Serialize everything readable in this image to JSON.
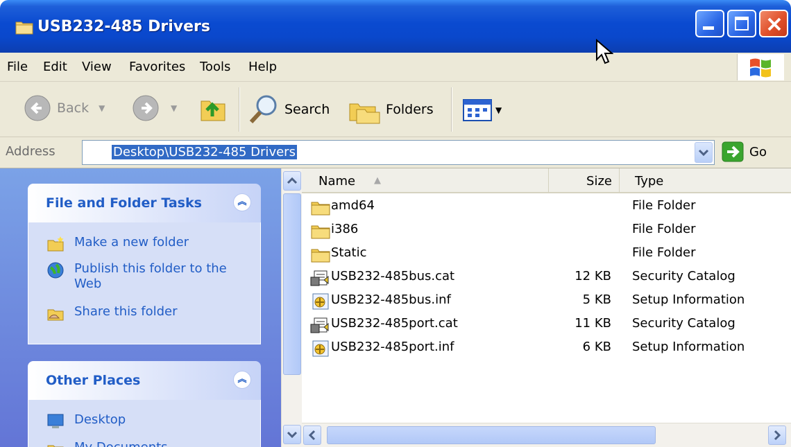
{
  "window": {
    "title": "USB232-485 Drivers",
    "icon": "folder-icon",
    "controls": [
      "minimize-icon",
      "maximize-icon",
      "close-icon"
    ]
  },
  "menu": {
    "items": [
      "File",
      "Edit",
      "View",
      "Favorites",
      "Tools",
      "Help"
    ]
  },
  "toolbar": {
    "back_label": "Back",
    "search_label": "Search",
    "folders_label": "Folders"
  },
  "address": {
    "label": "Address",
    "value": "Desktop\\USB232-485 Drivers",
    "go_label": "Go"
  },
  "taskpane": {
    "file_tasks": {
      "title": "File and Folder Tasks",
      "items": [
        {
          "label": "Make a new folder",
          "icon": "new-folder-icon"
        },
        {
          "label": "Publish this folder to the Web",
          "icon": "publish-web-icon"
        },
        {
          "label": "Share this folder",
          "icon": "share-folder-icon"
        }
      ]
    },
    "other_places": {
      "title": "Other Places",
      "items": [
        {
          "label": "Desktop",
          "icon": "desktop-icon"
        },
        {
          "label": "My Documents",
          "icon": "my-documents-icon"
        }
      ]
    }
  },
  "listview": {
    "columns": [
      "Name",
      "Size",
      "Type"
    ],
    "files": [
      {
        "name": "amd64",
        "size": "",
        "type": "File Folder",
        "icon": "folder-icon"
      },
      {
        "name": "i386",
        "size": "",
        "type": "File Folder",
        "icon": "folder-icon"
      },
      {
        "name": "Static",
        "size": "",
        "type": "File Folder",
        "icon": "folder-icon"
      },
      {
        "name": "USB232-485bus.cat",
        "size": "12 KB",
        "type": "Security Catalog",
        "icon": "security-catalog-icon"
      },
      {
        "name": "USB232-485bus.inf",
        "size": "5 KB",
        "type": "Setup Information",
        "icon": "setup-info-icon"
      },
      {
        "name": "USB232-485port.cat",
        "size": "11 KB",
        "type": "Security Catalog",
        "icon": "security-catalog-icon"
      },
      {
        "name": "USB232-485port.inf",
        "size": "6 KB",
        "type": "Setup Information",
        "icon": "setup-info-icon"
      }
    ]
  },
  "colors": {
    "titlebar": "#0a48cc",
    "chrome": "#ece9d8",
    "taskpane_link": "#215dc6",
    "selection": "#316ac5"
  }
}
